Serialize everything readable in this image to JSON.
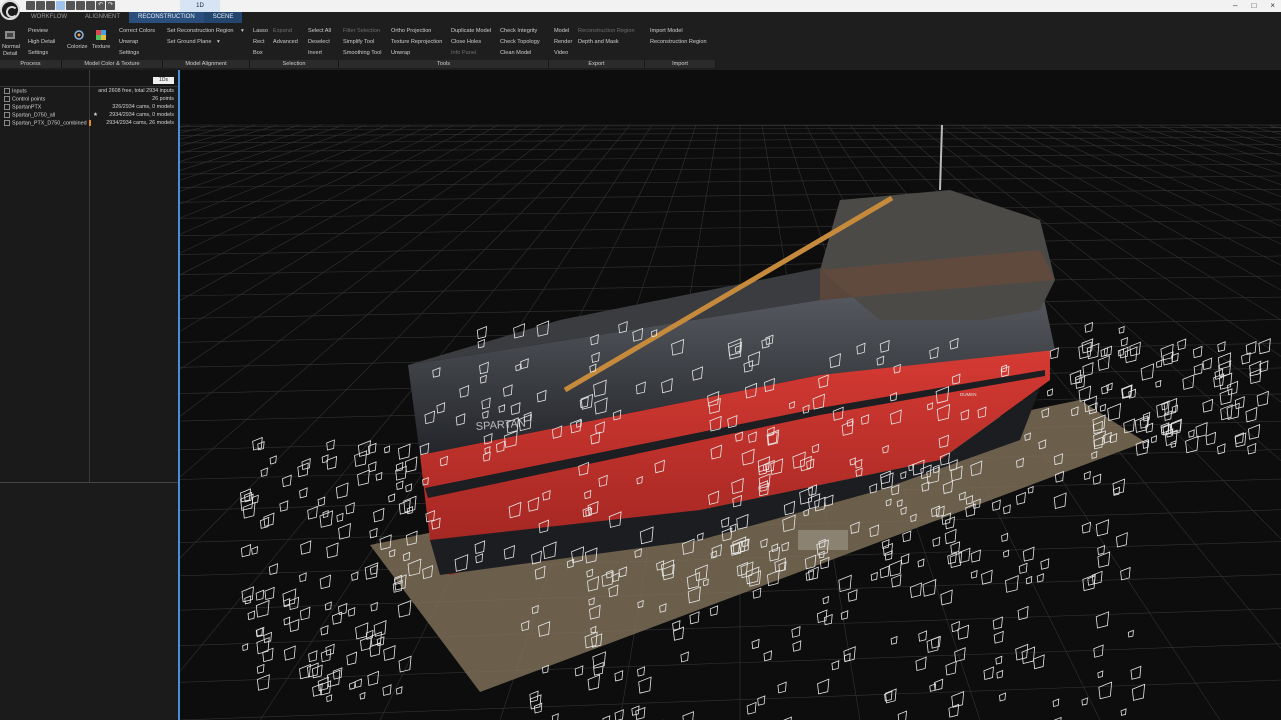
{
  "titlebar": {
    "doc_tab_1": "",
    "doc_tab_active": "1D"
  },
  "ribbon": {
    "tabs": [
      {
        "label": "WORKFLOW"
      },
      {
        "label": "ALIGNMENT"
      },
      {
        "label": "RECONSTRUCTION"
      },
      {
        "label": "SCENE"
      }
    ],
    "process": {
      "normal_detail_line1": "Normal",
      "normal_detail_line2": "Detail",
      "preview": "Preview",
      "high_detail": "High Detail",
      "settings": "Settings",
      "group": "Process"
    },
    "color_texture": {
      "colorize": "Colorize",
      "texture": "Texture",
      "correct_colors": "Correct Colors",
      "unwrap": "Unwrap",
      "settings": "Settings",
      "group": "Model Color & Texture"
    },
    "alignment": {
      "set_reconstruction_region": "Set Reconstruction Region",
      "set_ground_plane": "Set Ground Plane",
      "group": "Model Alignment"
    },
    "selection": {
      "lasso": "Lasso",
      "rect": "Rect",
      "box": "Box",
      "expand": "Expand",
      "advanced": "Advanced",
      "select_all": "Select All",
      "deselect": "Deselect",
      "invert": "Invert",
      "group": "Selection"
    },
    "tools": {
      "filter_selection": "Filter Selection",
      "simplify_tool": "Simplify Tool",
      "smoothing_tool": "Smoothing Tool",
      "ortho_projection": "Ortho Projection",
      "texture_reprojection": "Texture Reprojection",
      "unwrap": "Unwrap",
      "duplicate_model": "Duplicate Model",
      "close_holes": "Close Holes",
      "info_panel": "Info Panel",
      "check_integrity": "Check Integrity",
      "check_topology": "Check Topology",
      "clean_model": "Clean Model",
      "group": "Tools"
    },
    "export": {
      "model": "Model",
      "render": "Render",
      "video": "Video",
      "reconstruction_region": "Reconstruction Region",
      "depth_and_mask": "Depth and Mask",
      "group": "Export"
    },
    "import": {
      "import_model": "Import Model",
      "reconstruction_region": "Reconstruction Region",
      "group": "Import"
    }
  },
  "left_panel": {
    "header_box": "1Ds",
    "tree": [
      {
        "name": "Inputs",
        "info": "and 2608 free, total 2934 inputs"
      },
      {
        "name": "Control points",
        "info": "26 points"
      },
      {
        "name": "SpartanPTX",
        "info": "326/2934 cams, 0 models"
      },
      {
        "name": "Spartan_D750_all",
        "info": "2934/2934 cams, 0 models"
      },
      {
        "name": "Spartan_PTX_D750_combined",
        "info": "2934/2934 cams, 26 models"
      }
    ]
  },
  "viewport": {
    "hull_name": "SPARTAN",
    "stern_label": "DUMEN",
    "colors": {
      "hull_red": "#c8322c",
      "hull_dark": "#2b2d33",
      "boom": "#c58a3c",
      "ground": "#7d6e58",
      "grid": "#3a3a3a",
      "camera_frustum": "#e8e8e8",
      "accent": "#4a8ed8"
    }
  }
}
